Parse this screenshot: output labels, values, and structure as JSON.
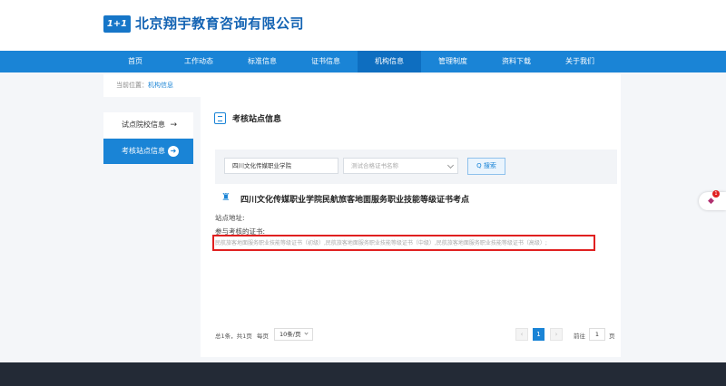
{
  "header": {
    "logo_mark": "1+1",
    "title": "北京翔宇教育咨询有限公司"
  },
  "nav": [
    "首页",
    "工作动态",
    "标准信息",
    "证书信息",
    "机构信息",
    "管理制度",
    "资料下载",
    "关于我们"
  ],
  "nav_active": "机构信息",
  "breadcrumb": {
    "prefix": "当前位置：",
    "current": "机构信息"
  },
  "sidebar": {
    "items": [
      {
        "label": "试点院校信息",
        "icon": "arrow-right-icon",
        "glyph": "→"
      },
      {
        "label": "考核站点信息",
        "icon": "arrow-circle-icon",
        "glyph": "➜"
      }
    ]
  },
  "section_title": "考核站点信息",
  "search": {
    "school_value": "四川文化传媒职业学院",
    "cert_placeholder": "测试合格证书名称",
    "button": "Q 搜索"
  },
  "site": {
    "icon_glyph": "♜",
    "title": "四川文化传媒职业学院民航旅客地面服务职业技能等级证书考点",
    "address_label": "站点地址:",
    "cert_label": "参与考核的证书:",
    "certs": "民航旅客地面服务职业技能等级证书（初级）,民航旅客地面服务职业技能等级证书（中级）,民航旅客地面服务职业技能等级证书（高级）;"
  },
  "pagination": {
    "summary": "总1条，共1页",
    "per_page_label": "每页",
    "per_page": "10条/页",
    "prev": "‹",
    "page": "1",
    "next": "›",
    "goto_label": "前往",
    "goto_value": "1",
    "page_unit": "页"
  },
  "float_widget": {
    "badge": "1",
    "glyph": "◆"
  },
  "colors": {
    "primary": "#1a84d6",
    "nav_active": "#0e6ec0",
    "footer": "#232a36",
    "highlight": "#e02020"
  }
}
